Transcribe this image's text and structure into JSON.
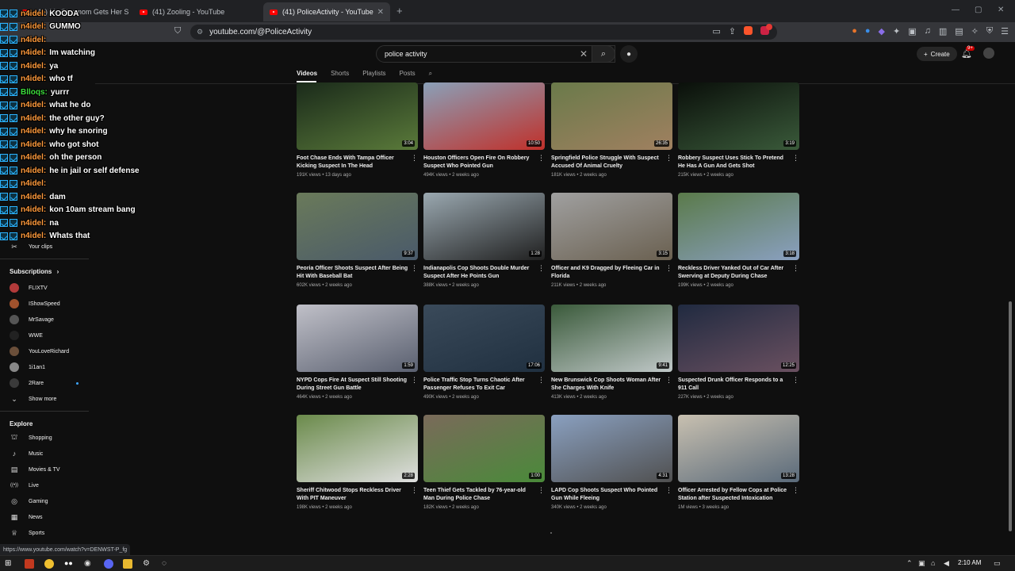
{
  "browser": {
    "tabs": [
      {
        "title": "(41) My Stepmom Gets Her Son Is A Wan..."
      },
      {
        "title": "(41) Zooling - YouTube"
      },
      {
        "title": "(41) PoliceActivity - YouTube"
      }
    ],
    "url": "youtube.com/@PoliceActivity",
    "status_url": "https://www.youtube.com/watch?v=DENWST-P_fg"
  },
  "youtube": {
    "search_query": "police activity",
    "create_label": "Create",
    "notif_count": "9+",
    "channel_tabs": [
      "Videos",
      "Shorts",
      "Playlists",
      "Posts"
    ]
  },
  "sidebar": {
    "your_clips": "Your clips",
    "subscriptions_label": "Subscriptions",
    "subscriptions": [
      {
        "name": "FLIXTV",
        "color": "#b23a3a"
      },
      {
        "name": "IShowSpeed",
        "color": "#a0522d"
      },
      {
        "name": "MrSavage",
        "color": "#555555"
      },
      {
        "name": "WWE",
        "color": "#222222"
      },
      {
        "name": "YouLoveRichard",
        "color": "#6b4f3a"
      },
      {
        "name": "1i1an1",
        "color": "#888888"
      },
      {
        "name": "2Rare",
        "color": "#3a3a3a"
      }
    ],
    "show_more": "Show more",
    "explore_label": "Explore",
    "explore": [
      {
        "label": "Shopping",
        "icon": "shopping-bag-icon"
      },
      {
        "label": "Music",
        "icon": "music-icon"
      },
      {
        "label": "Movies & TV",
        "icon": "film-icon"
      },
      {
        "label": "Live",
        "icon": "live-icon"
      },
      {
        "label": "Gaming",
        "icon": "gaming-icon"
      },
      {
        "label": "News",
        "icon": "news-icon"
      },
      {
        "label": "Sports",
        "icon": "trophy-icon"
      }
    ]
  },
  "chat": [
    {
      "user": "n4idel",
      "msg": "KOODA"
    },
    {
      "user": "n4idel",
      "msg": "GUMMO"
    },
    {
      "user": "n4idel",
      "msg": ""
    },
    {
      "user": "n4idel",
      "msg": "Im watching"
    },
    {
      "user": "n4idel",
      "msg": "ya"
    },
    {
      "user": "n4idel",
      "msg": "who tf"
    },
    {
      "user": "Blloqs",
      "msg": "yurrr"
    },
    {
      "user": "n4idel",
      "msg": "what he do"
    },
    {
      "user": "n4idel",
      "msg": "the other guy?"
    },
    {
      "user": "n4idel",
      "msg": "why he snoring"
    },
    {
      "user": "n4idel",
      "msg": "who got shot"
    },
    {
      "user": "n4idel",
      "msg": "oh the person"
    },
    {
      "user": "n4idel",
      "msg": "he in jail or self defense"
    },
    {
      "user": "n4idel",
      "msg": ""
    },
    {
      "user": "n4idel",
      "msg": "dam"
    },
    {
      "user": "n4idel",
      "msg": "kon 10am stream bang"
    },
    {
      "user": "n4idel",
      "msg": "na"
    },
    {
      "user": "n4idel",
      "msg": "Whats that"
    }
  ],
  "videos": [
    {
      "title": "Foot Chase Ends With Tampa Officer Kicking Suspect In The Head",
      "views": "191K views",
      "age": "13 days ago",
      "duration": "3:04",
      "colors": [
        "#1a2a1a",
        "#5a7a3a"
      ]
    },
    {
      "title": "Houston Officers Open Fire On Robbery Suspect Who Pointed Gun",
      "views": "494K views",
      "age": "2 weeks ago",
      "duration": "10:50",
      "colors": [
        "#8aa0b8",
        "#c0302a"
      ]
    },
    {
      "title": "Springfield Police Struggle With Suspect Accused Of Animal Cruelty",
      "views": "181K views",
      "age": "2 weeks ago",
      "duration": "26:35",
      "colors": [
        "#6a7a4a",
        "#a08060"
      ]
    },
    {
      "title": "Robbery Suspect Uses Stick To Pretend He Has A Gun And Gets Shot",
      "views": "215K views",
      "age": "2 weeks ago",
      "duration": "3:19",
      "colors": [
        "#0a0f0a",
        "#3a5a3a"
      ]
    },
    {
      "title": "Peoria Officer Shoots Suspect After Being Hit With Baseball Bat",
      "views": "602K views",
      "age": "2 weeks ago",
      "duration": "9:37",
      "colors": [
        "#6a7a5a",
        "#4a5a6a"
      ]
    },
    {
      "title": "Indianapolis Cop Shoots Double Murder Suspect After He Points Gun",
      "views": "388K views",
      "age": "2 weeks ago",
      "duration": "1:28",
      "colors": [
        "#9aa8b0",
        "#202020"
      ]
    },
    {
      "title": "Officer and K9 Dragged by Fleeing Car in Florida",
      "views": "211K views",
      "age": "2 weeks ago",
      "duration": "3:15",
      "colors": [
        "#a0a0a0",
        "#6a6050"
      ]
    },
    {
      "title": "Reckless Driver Yanked Out of Car After Swerving at Deputy During Chase",
      "views": "199K views",
      "age": "2 weeks ago",
      "duration": "3:18",
      "colors": [
        "#5a7a4a",
        "#8aa0c0"
      ]
    },
    {
      "title": "NYPD Cops Fire At Suspect Still Shooting During Street Gun Battle",
      "views": "464K views",
      "age": "2 weeks ago",
      "duration": "1:59",
      "colors": [
        "#c0c0c8",
        "#5a6070"
      ]
    },
    {
      "title": "Police Traffic Stop Turns Chaotic After Passenger Refuses To Exit Car",
      "views": "490K views",
      "age": "2 weeks ago",
      "duration": "17:06",
      "colors": [
        "#3a4a5a",
        "#203040"
      ]
    },
    {
      "title": "New Brunswick Cop Shoots Woman After She Charges With Knife",
      "views": "413K views",
      "age": "2 weeks ago",
      "duration": "9:41",
      "colors": [
        "#3a5a3a",
        "#c0c8c8"
      ]
    },
    {
      "title": "Suspected Drunk Officer Responds to a 911 Call",
      "views": "227K views",
      "age": "2 weeks ago",
      "duration": "12:25",
      "colors": [
        "#202a40",
        "#6a5060"
      ]
    },
    {
      "title": "Sheriff Chitwood Stops Reckless Driver With PIT Maneuver",
      "views": "198K views",
      "age": "2 weeks ago",
      "duration": "2:28",
      "colors": [
        "#6a8a4a",
        "#e0e0e0"
      ]
    },
    {
      "title": "Teen Thief Gets Tackled by 76-year-old Man During Police Chase",
      "views": "182K views",
      "age": "2 weeks ago",
      "duration": "1:00",
      "colors": [
        "#7a6a5a",
        "#4a8a3a"
      ]
    },
    {
      "title": "LAPD Cop Shoots Suspect Who Pointed Gun While Fleeing",
      "views": "340K views",
      "age": "2 weeks ago",
      "duration": "4:31",
      "colors": [
        "#8aa0c0",
        "#505050"
      ]
    },
    {
      "title": "Officer Arrested by Fellow Cops at Police Station after Suspected Intoxication",
      "views": "1M views",
      "age": "3 weeks ago",
      "duration": "13:28",
      "colors": [
        "#c8c0b0",
        "#5a6a7a"
      ]
    }
  ],
  "taskbar": {
    "time": "2:10 AM"
  }
}
